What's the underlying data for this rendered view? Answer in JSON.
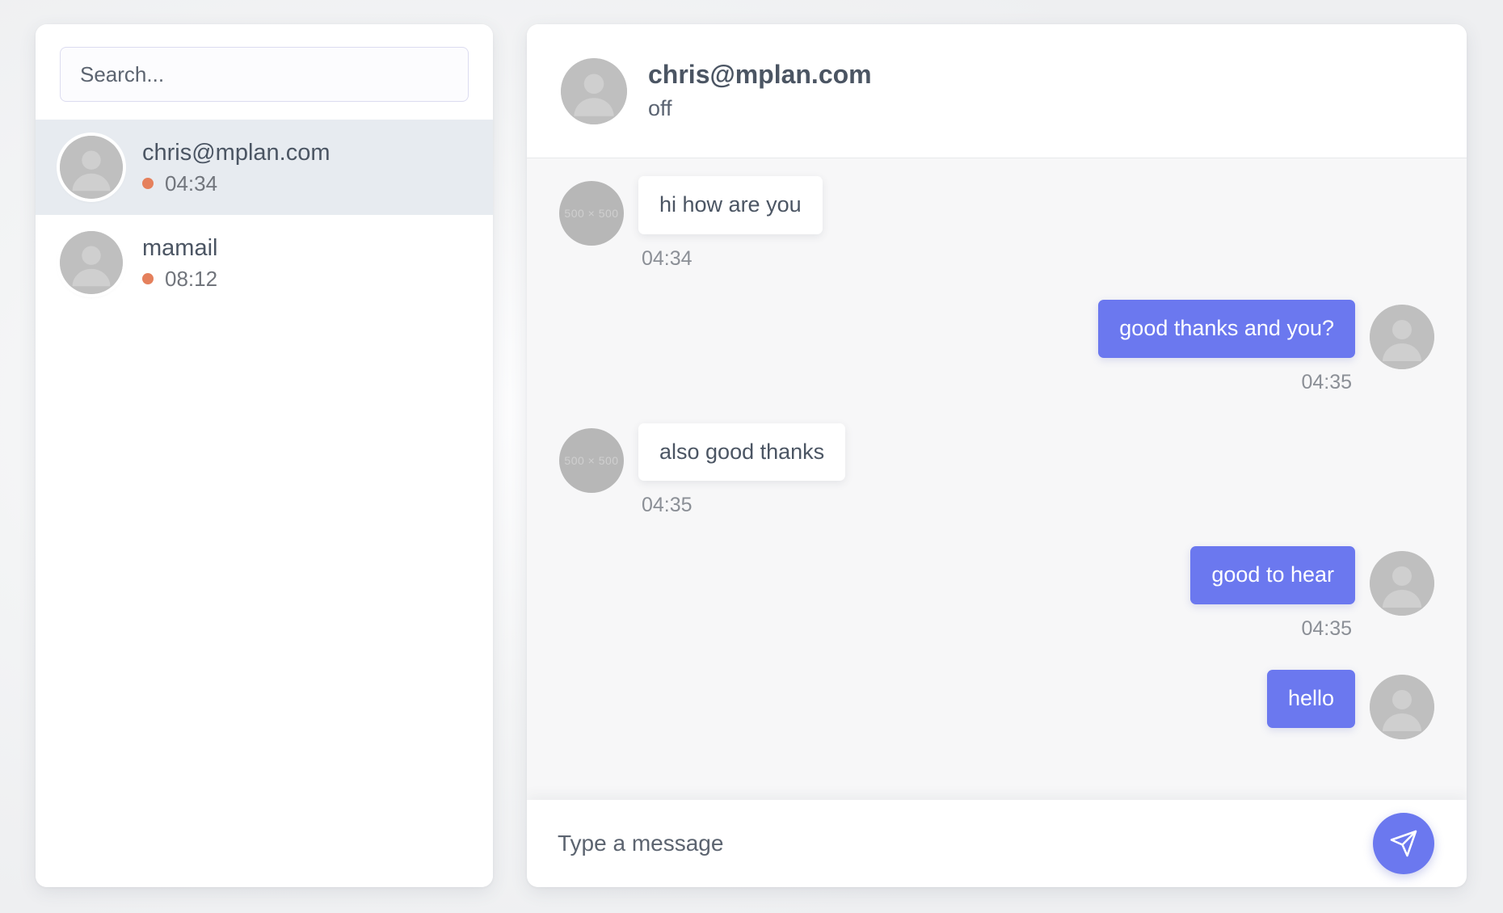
{
  "sidebar": {
    "search": {
      "placeholder": "Search...",
      "value": "",
      "icon": "search-input"
    },
    "conversations": [
      {
        "name": "chris@mplan.com",
        "time": "04:34",
        "status_dot_color": "#e5805c",
        "selected": true,
        "avatar_icon": "person-avatar-icon"
      },
      {
        "name": "mamail",
        "time": "08:12",
        "status_dot_color": "#e5805c",
        "selected": false,
        "avatar_icon": "person-avatar-icon"
      }
    ]
  },
  "chat": {
    "header": {
      "title": "chris@mplan.com",
      "status": "off",
      "avatar_icon": "person-avatar-icon"
    },
    "messages": [
      {
        "direction": "in",
        "text": "hi how are you",
        "time": "04:34",
        "avatar_placeholder": "500 × 500"
      },
      {
        "direction": "out",
        "text": "good thanks and you?",
        "time": "04:35",
        "avatar_icon": "person-avatar-icon"
      },
      {
        "direction": "in",
        "text": "also good thanks",
        "time": "04:35",
        "avatar_placeholder": "500 × 500"
      },
      {
        "direction": "out",
        "text": "good to hear",
        "time": "04:35",
        "avatar_icon": "person-avatar-icon"
      },
      {
        "direction": "out",
        "text": "hello",
        "time": "",
        "avatar_icon": "person-avatar-icon"
      }
    ],
    "composer": {
      "placeholder": "Type a message",
      "value": "",
      "send_icon": "send-paper-plane-icon"
    }
  },
  "colors": {
    "accent_blue": "#6b78ef",
    "status_orange": "#e5805c",
    "selected_item_bg": "#e7ebf0",
    "chat_bg": "#f7f7f8",
    "panel_bg": "#ffffff",
    "page_bg": "#f4f5f6",
    "text_primary": "#4b5563",
    "text_muted": "#8b8f96"
  }
}
